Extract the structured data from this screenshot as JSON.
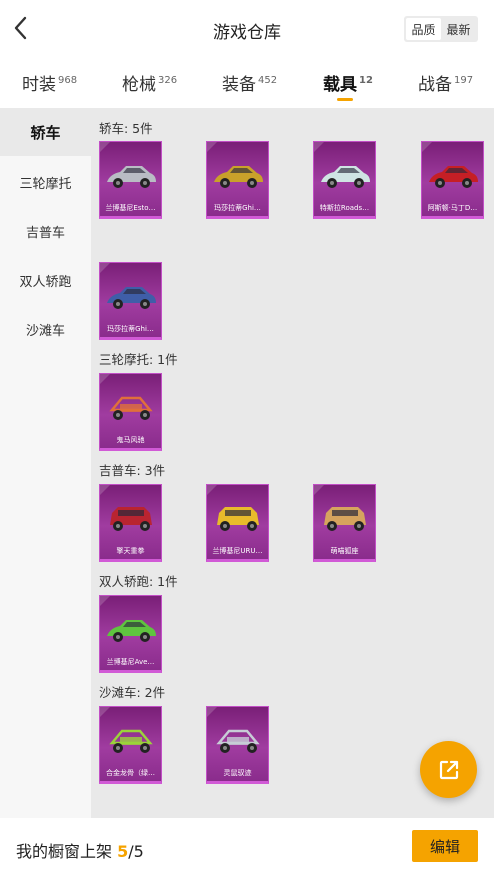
{
  "header": {
    "title": "游戏仓库",
    "sort_options": [
      "品质",
      "最新"
    ],
    "sort_active": "品质"
  },
  "tabs": [
    {
      "label": "时装",
      "count": "968"
    },
    {
      "label": "枪械",
      "count": "326"
    },
    {
      "label": "装备",
      "count": "452"
    },
    {
      "label": "载具",
      "count": "12",
      "active": true
    },
    {
      "label": "战备",
      "count": "197"
    }
  ],
  "sidebar": {
    "items": [
      {
        "label": "轿车",
        "active": true
      },
      {
        "label": "三轮摩托"
      },
      {
        "label": "吉普车"
      },
      {
        "label": "双人轿跑"
      },
      {
        "label": "沙滩车"
      }
    ]
  },
  "groups": [
    {
      "title": "轿车: 5件",
      "items": [
        {
          "name": "兰博基尼Esto…",
          "icon": "silver-sports-car",
          "color": "#b9bcc4"
        },
        {
          "name": "玛莎拉蒂Ghi…",
          "icon": "gold-sedan",
          "color": "#c9a12a"
        },
        {
          "name": "特斯拉Roads…",
          "icon": "white-roadster",
          "color": "#cfe4e3"
        },
        {
          "name": "阿斯顿·马丁D…",
          "icon": "red-sports-car",
          "color": "#c61f25"
        },
        {
          "name": "玛莎拉蒂Ghi…",
          "icon": "blue-sedan",
          "color": "#3f5ea8"
        }
      ]
    },
    {
      "title": "三轮摩托: 1件",
      "items": [
        {
          "name": "鬼马风驰",
          "icon": "flame-trike",
          "color": "#e0703a"
        }
      ]
    },
    {
      "title": "吉普车: 3件",
      "items": [
        {
          "name": "擎天重拳",
          "icon": "red-jeep",
          "color": "#b92430"
        },
        {
          "name": "兰博基尼URU…",
          "icon": "yellow-suv",
          "color": "#e8bb2b"
        },
        {
          "name": "萌喵狐座",
          "icon": "cat-beetle-car",
          "color": "#d6a45e"
        }
      ]
    },
    {
      "title": "双人轿跑: 1件",
      "items": [
        {
          "name": "兰博基尼Ave…",
          "icon": "green-supercar",
          "color": "#5fc43f"
        }
      ]
    },
    {
      "title": "沙滩车: 2件",
      "items": [
        {
          "name": "合金龙骨（绿…",
          "icon": "green-buggy",
          "color": "#9bd33a"
        },
        {
          "name": "灵鼠驭迹",
          "icon": "silver-buggy",
          "color": "#c7ccd6"
        }
      ]
    }
  ],
  "footer": {
    "label": "我的橱窗上架",
    "count_current": "5",
    "count_total": "/5",
    "edit_label": "编辑"
  },
  "colors": {
    "accent": "#f5a300",
    "card": "#9a3a9c"
  }
}
